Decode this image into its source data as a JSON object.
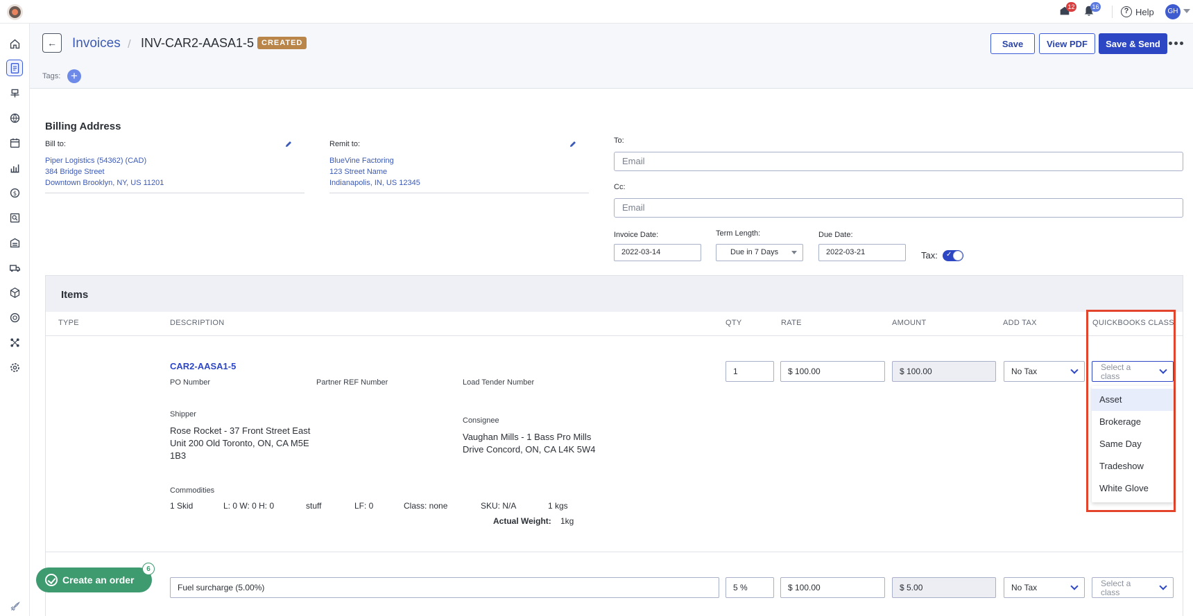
{
  "topbar": {
    "inbox_count": "12",
    "notifications_count": "16",
    "help_label": "Help",
    "user_initials": "GH"
  },
  "header": {
    "breadcrumb_parent": "Invoices",
    "breadcrumb_separator": "/",
    "invoice_id": "INV-CAR2-AASA1-5",
    "status": "CREATED",
    "save_label": "Save",
    "view_pdf_label": "View PDF",
    "save_send_label": "Save & Send"
  },
  "tags": {
    "label": "Tags:"
  },
  "billing": {
    "title": "Billing Address",
    "bill_to_label": "Bill to:",
    "bill_to_lines": [
      "Piper Logistics (54362) (CAD)",
      "384 Bridge Street",
      "Downtown Brooklyn, NY, US 11201"
    ],
    "remit_to_label": "Remit to:",
    "remit_to_lines": [
      "BlueVine Factoring",
      "123 Street Name",
      "Indianapolis, IN, US 12345"
    ],
    "to_label": "To:",
    "to_placeholder": "Email",
    "cc_label": "Cc:",
    "cc_placeholder": "Email",
    "invoice_date_label": "Invoice Date:",
    "invoice_date": "2022-03-14",
    "term_length_label": "Term Length:",
    "term_length": "Due in 7 Days",
    "due_date_label": "Due Date:",
    "due_date": "2022-03-21",
    "tax_label": "Tax:",
    "tax_enabled": true
  },
  "items": {
    "title": "Items",
    "columns": [
      "TYPE",
      "DESCRIPTION",
      "QTY",
      "RATE",
      "AMOUNT",
      "ADD TAX",
      "QUICKBOOKS CLASS"
    ],
    "row1": {
      "load_ref": "CAR2-AASA1-5",
      "po_label": "PO Number",
      "partner_ref_label": "Partner REF Number",
      "load_tender_label": "Load Tender Number",
      "shipper_label": "Shipper",
      "shipper_lines": [
        "Rose Rocket - 37 Front Street East",
        "Unit 200 Old Toronto, ON, CA M5E",
        "1B3"
      ],
      "consignee_label": "Consignee",
      "consignee_lines": [
        "Vaughan Mills - 1 Bass Pro Mills",
        "Drive Concord, ON, CA L4K 5W4"
      ],
      "commodities_label": "Commodities",
      "commodity": [
        "1 Skid",
        "L: 0 W: 0 H: 0",
        "stuff",
        "LF: 0",
        "Class: none",
        "SKU: N/A",
        "1 kgs"
      ],
      "actual_weight_label": "Actual Weight:",
      "actual_weight": "1kg",
      "qty": "1",
      "rate": "$ 100.00",
      "amount": "$ 100.00",
      "tax": "No Tax",
      "class_placeholder": "Select a class"
    },
    "row2": {
      "description": "Fuel surcharge (5.00%)",
      "qty": "5 %",
      "rate": "$ 100.00",
      "amount": "$ 5.00",
      "tax": "No Tax",
      "class_placeholder": "Select a class"
    },
    "class_options": [
      "Asset",
      "Brokerage",
      "Same Day",
      "Tradeshow",
      "White Glove"
    ],
    "selected_class_option": "Asset"
  },
  "fab": {
    "label": "Create an order",
    "count": "6"
  },
  "colors": {
    "accent": "#2d47c4",
    "status_badge": "#b98549",
    "highlight": "#e2452b",
    "fab": "#3e9a6f"
  }
}
